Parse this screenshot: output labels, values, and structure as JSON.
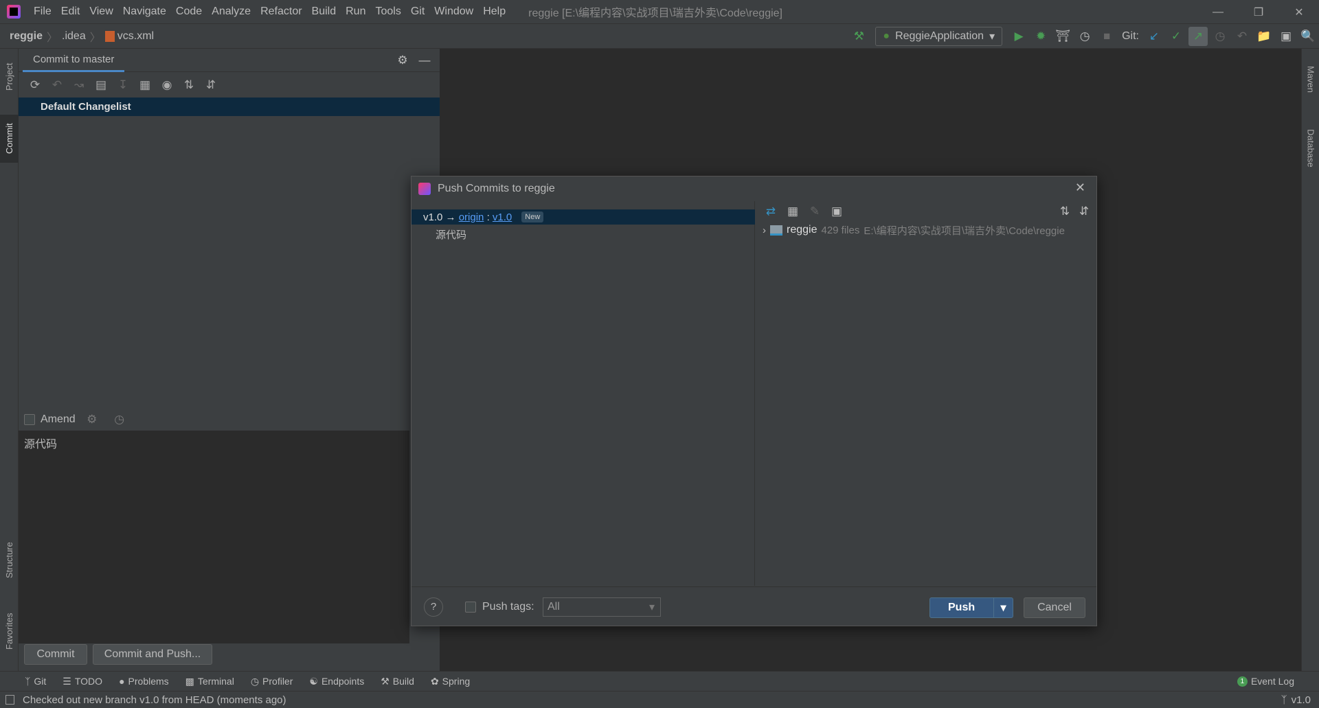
{
  "menubar": {
    "items": [
      "File",
      "Edit",
      "View",
      "Navigate",
      "Code",
      "Analyze",
      "Refactor",
      "Build",
      "Run",
      "Tools",
      "Git",
      "Window",
      "Help"
    ],
    "window_title": "reggie [E:\\编程内容\\实战项目\\瑞吉外卖\\Code\\reggie]"
  },
  "navbar": {
    "crumbs": [
      "reggie",
      ".idea",
      "vcs.xml"
    ],
    "run_config": "ReggieApplication",
    "git_label": "Git:"
  },
  "left_stripe": {
    "project": "Project",
    "commit": "Commit",
    "structure": "Structure",
    "favorites": "Favorites"
  },
  "right_stripe": {
    "maven": "Maven",
    "database": "Database"
  },
  "commit_panel": {
    "tab": "Commit to master",
    "changelist": "Default Changelist",
    "amend": "Amend",
    "message": "源代码",
    "commit_btn": "Commit",
    "commit_push_btn": "Commit and Push..."
  },
  "dialog": {
    "title": "Push Commits to reggie",
    "branch": "v1.0",
    "arrow": "→",
    "remote": "origin",
    "sep": ":",
    "remote_branch": "v1.0",
    "badge": "New",
    "commit": "源代码",
    "repo": "reggie",
    "files": "429 files",
    "path": "E:\\编程内容\\实战项目\\瑞吉外卖\\Code\\reggie",
    "help": "?",
    "push_tags": "Push tags:",
    "tags_value": "All",
    "push": "Push",
    "cancel": "Cancel"
  },
  "bottom_tools": [
    "Git",
    "TODO",
    "Problems",
    "Terminal",
    "Profiler",
    "Endpoints",
    "Build",
    "Spring"
  ],
  "event_log": {
    "count": "1",
    "label": "Event Log"
  },
  "status": {
    "message": "Checked out new branch v1.0 from HEAD (moments ago)",
    "branch": "v1.0"
  },
  "colors": {
    "accent": "#4a88c7",
    "selection": "#0d293e",
    "link": "#589df6",
    "push_button": "#365880"
  }
}
